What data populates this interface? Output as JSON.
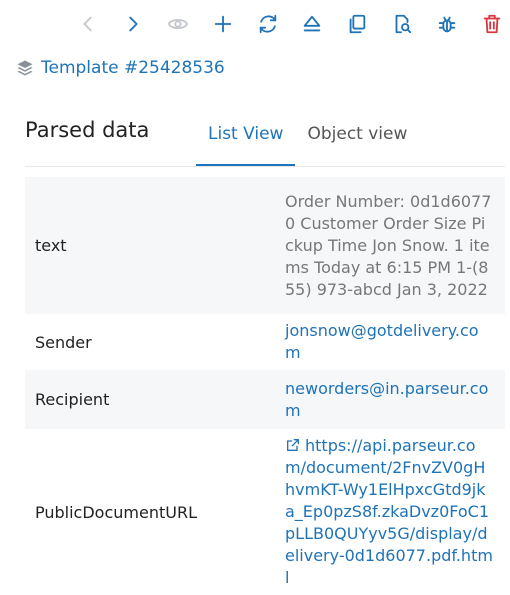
{
  "toolbar": {
    "icons": [
      "back-icon",
      "forward-icon",
      "eye-icon",
      "plus-icon",
      "refresh-icon",
      "eject-icon",
      "copy-icon",
      "search-document-icon",
      "bug-icon",
      "trash-icon"
    ]
  },
  "breadcrumb": {
    "icon": "layers-icon",
    "template_label": "Template #25428536"
  },
  "parsed_data": {
    "title": "Parsed data",
    "tabs": [
      {
        "label": "List View",
        "active": true
      },
      {
        "label": "Object view",
        "active": false
      }
    ],
    "rows": [
      {
        "key": "text",
        "value": "Order Number: 0d1d60770 Customer Order Size Pickup Time Jon Snow. 1 items Today at 6:15 PM 1-(855) 973-abcd Jan 3, 2022"
      },
      {
        "key": "Sender",
        "value": "jonsnow@gotdelivery.com"
      },
      {
        "key": "Recipient",
        "value": "neworders@in.parseur.com"
      },
      {
        "key": "PublicDocumentURL",
        "value": "https://api.parseur.com/document/2FnvZV0gHhvmKT-Wy1ElHpxcGtd9jka_Ep0pzS8f.zkaDvz0FoC1pLLB0QUYyv5G/display/delivery-0d1d6077.pdf.html"
      }
    ]
  },
  "colors": {
    "accent": "#1f73b7",
    "danger": "#d9363e",
    "disabled": "#c4c8cc",
    "row_stripe": "#f5f7f9"
  }
}
